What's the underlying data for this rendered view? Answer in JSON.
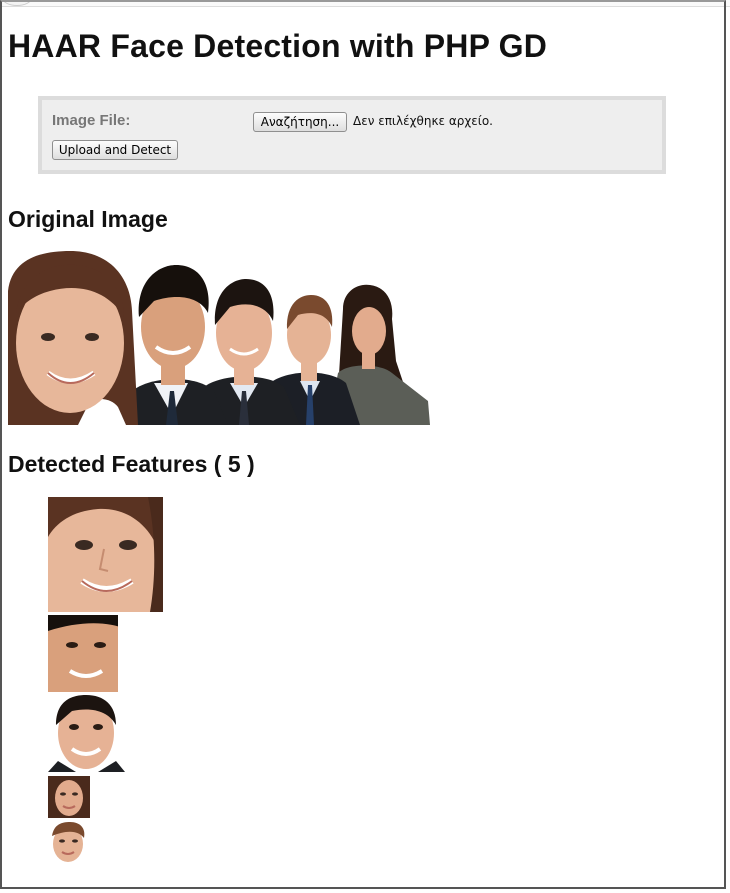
{
  "page": {
    "title": "HAAR Face Detection with PHP GD",
    "form": {
      "file_label": "Image File:",
      "browse_label": "Αναζήτηση...",
      "file_status": "Δεν επιλέχθηκε αρχείο.",
      "submit_label": "Upload and Detect"
    },
    "original_heading": "Original Image",
    "detected_heading": "Detected Features ( 5 )"
  },
  "colors": {
    "skin": "#e7b79a",
    "hair_brown": "#5a3322",
    "hair_dark": "#1c1410",
    "suit": "#1e2024",
    "shirt": "#dfe6f0",
    "form_bg": "#eeeeee",
    "form_border": "#dcdcdc"
  }
}
